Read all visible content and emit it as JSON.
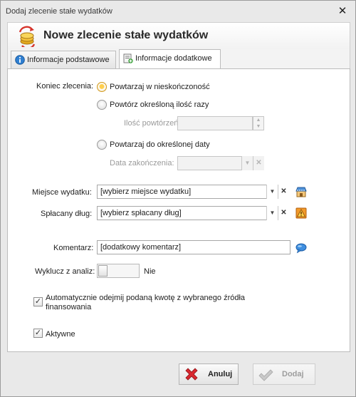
{
  "window": {
    "title": "Dodaj zlecenie stałe wydatków",
    "close_glyph": "✕"
  },
  "header": {
    "title": "Nowe zlecenie stałe wydatków",
    "icon": "coins-arrows-icon"
  },
  "tabs": [
    {
      "label": "Informacje podstawowe",
      "icon": "info-icon",
      "active": false
    },
    {
      "label": "Informacje dodatkowe",
      "icon": "form-add-icon",
      "active": true
    }
  ],
  "end_order": {
    "label": "Koniec zlecenia:",
    "options": [
      {
        "label": "Powtarzaj w nieskończoność",
        "checked": true
      },
      {
        "label": "Powtórz określoną ilość razy",
        "checked": false
      },
      {
        "label": "Powtarzaj do określonej daty",
        "checked": false
      }
    ],
    "repeat_count_label": "Ilość powtórzeń:",
    "repeat_count_value": "",
    "end_date_label": "Data zakończenia:",
    "end_date_value": ""
  },
  "expense_place": {
    "label": "Miejsce wydatku:",
    "value": "[wybierz miejsce wydatku]",
    "icon": "shop-icon"
  },
  "debt": {
    "label": "Spłacany dług:",
    "value": "[wybierz spłacany dług]",
    "icon": "warning-icon"
  },
  "comment": {
    "label": "Komentarz:",
    "value": "[dodatkowy komentarz]",
    "icon": "speech-bubble-icon"
  },
  "exclude": {
    "label": "Wyklucz z analiz:",
    "state_text": "Nie",
    "on": false
  },
  "auto_deduct": {
    "label": "Automatycznie odejmij podaną kwotę z wybranego źródła finansowania",
    "checked": true
  },
  "active": {
    "label": "Aktywne",
    "checked": true
  },
  "buttons": {
    "cancel": {
      "label": "Anuluj",
      "icon": "red-x-icon"
    },
    "add": {
      "label": "Dodaj",
      "icon": "checkmark-icon",
      "disabled": true
    }
  },
  "colors": {
    "radio_checked": "#ffcf4d",
    "cancel_icon": "#d9282f",
    "info_icon": "#2f7fd1"
  }
}
